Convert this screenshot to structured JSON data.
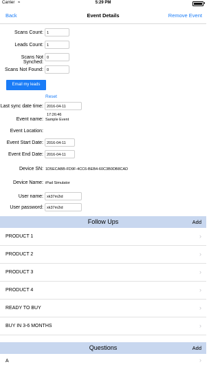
{
  "status_bar": {
    "carrier": "Carrier",
    "time": "5:29 PM"
  },
  "nav": {
    "back_label": "Back",
    "title": "Event Details",
    "remove_label": "Remove Event"
  },
  "counts": {
    "scans_count_label": "Scans Count:",
    "scans_count_value": "1",
    "leads_count_label": "Leads Count:",
    "leads_count_value": "1",
    "scans_not_synched_label": "Scans Not Synched:",
    "scans_not_synched_value": "0",
    "scans_not_found_label": "Scans Not Found:",
    "scans_not_found_value": "0"
  },
  "email_button_label": "Email my leads",
  "reset_label": "Reset",
  "details": {
    "last_sync_label": "Last sync date time:",
    "last_sync_value": "2016-04-11 17:26:46",
    "event_name_label": "Event name:",
    "event_name_value": "Sample Event",
    "event_location_label": "Event Location:",
    "event_location_value": "",
    "event_start_label": "Event Start Date:",
    "event_start_value": "2016-04-11",
    "event_end_label": "Event End Date:",
    "event_end_value": "2016-04-11",
    "device_sn_label": "Device SN:",
    "device_sn_value": "1D5ECABB-FD9F-4CC6-BEB4-60C3B0DB8CAD",
    "device_name_label": "Device Name:",
    "device_name_value": "iPad Simulator",
    "user_name_label": "User name:",
    "user_name_value": "xk37m2id",
    "user_password_label": "User password:",
    "user_password_value": "xk37m2id"
  },
  "follow_ups": {
    "title": "Follow Ups",
    "add_label": "Add",
    "items": [
      "PRODUCT 1",
      "PRODUCT 2",
      "PRODUCT 3",
      "PRODUCT 4",
      "READY TO BUY",
      "BUY IN 3-6 MONTHS"
    ]
  },
  "questions": {
    "title": "Questions",
    "add_label": "Add",
    "items": [
      "A"
    ]
  },
  "colors": {
    "accent": "#1a7cf7",
    "section_header": "#c8d7ef"
  }
}
